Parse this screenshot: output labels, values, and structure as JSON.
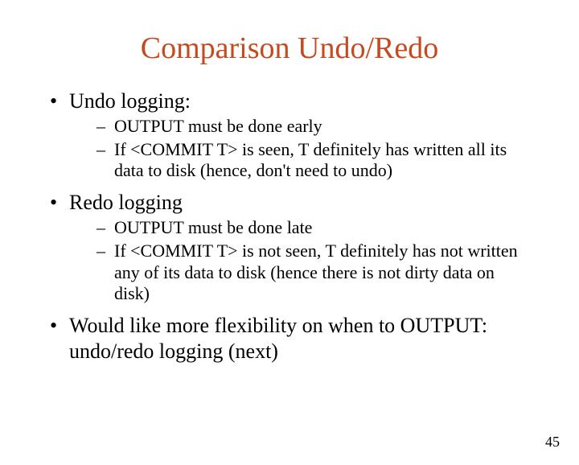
{
  "title": "Comparison Undo/Redo",
  "bullets": [
    {
      "text": "Undo logging:",
      "children": [
        "OUTPUT must be done early",
        "If <COMMIT T> is seen, T definitely has written all its data to disk (hence, don't need to undo)"
      ]
    },
    {
      "text": "Redo logging",
      "children": [
        "OUTPUT must be done late",
        "If <COMMIT T> is not seen, T definitely has not written any of its data to disk (hence there is not dirty data on disk)"
      ]
    },
    {
      "text": "Would like more flexibility on when to OUTPUT: undo/redo logging (next)",
      "children": []
    }
  ],
  "page_number": "45"
}
